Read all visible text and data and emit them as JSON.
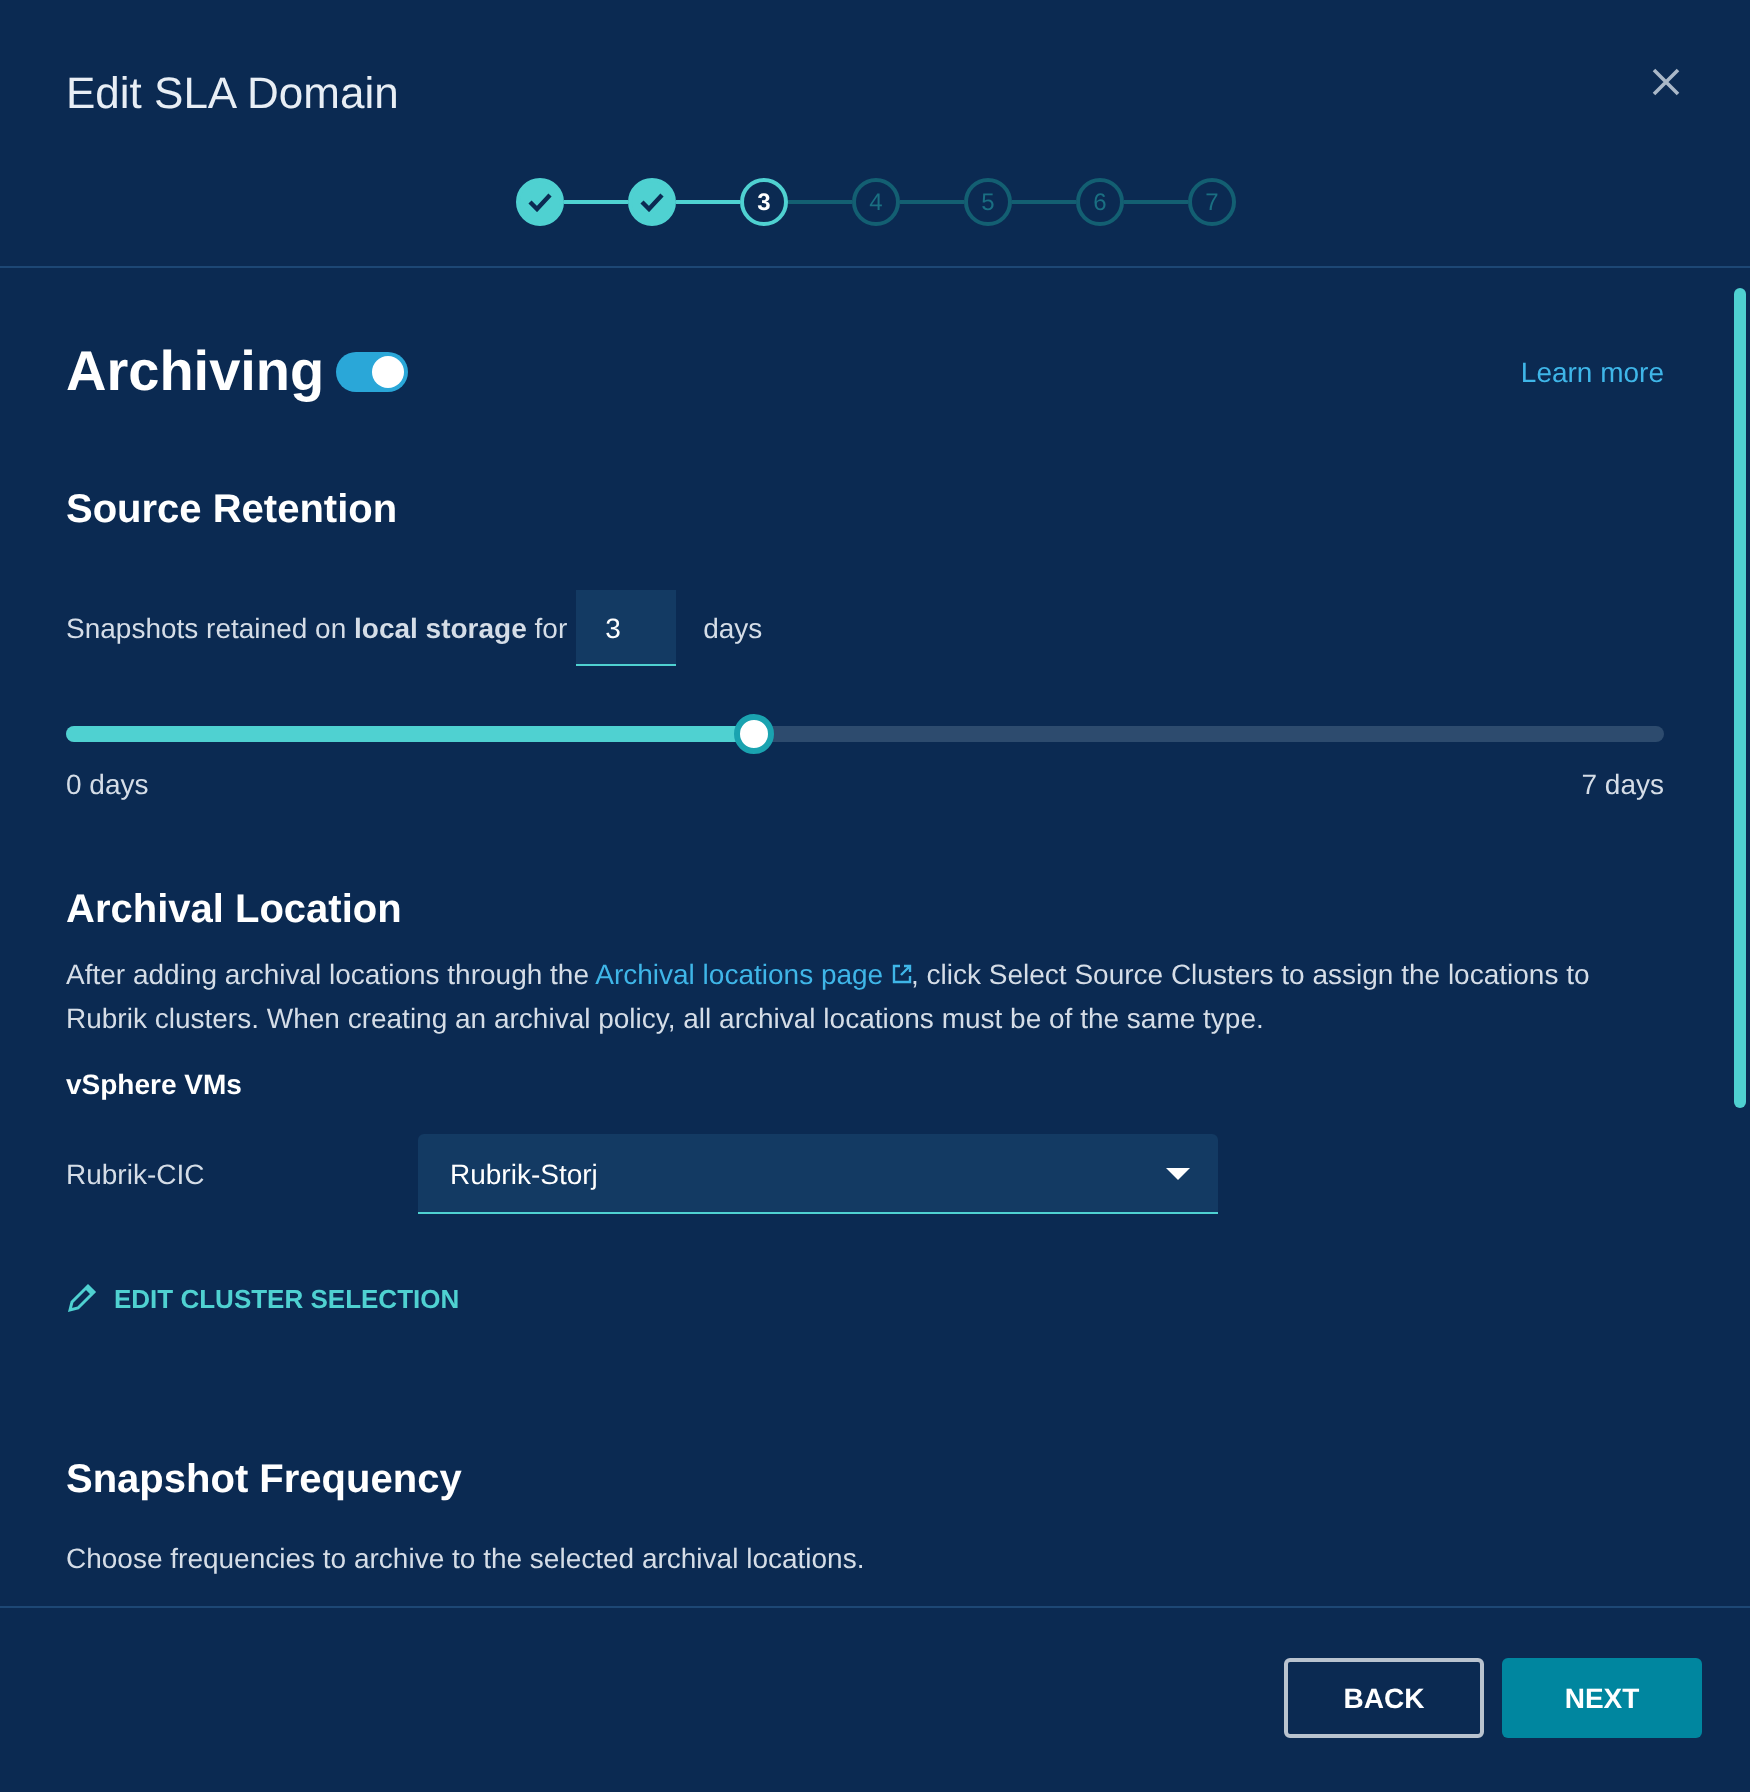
{
  "dialog": {
    "title": "Edit SLA Domain"
  },
  "steps": [
    {
      "completed": true,
      "selected": false
    },
    {
      "completed": true,
      "selected": false
    },
    {
      "label": "3",
      "completed": false,
      "selected": true
    },
    {
      "label": "4",
      "completed": false,
      "selected": false
    },
    {
      "label": "5",
      "completed": false,
      "selected": false
    },
    {
      "label": "6",
      "completed": false,
      "selected": false
    },
    {
      "label": "7",
      "completed": false,
      "selected": false
    }
  ],
  "archiving": {
    "title": "Archiving",
    "on": true,
    "learn_more": "Learn more"
  },
  "source_retention": {
    "heading": "Source Retention",
    "sentence": "Snapshots retained on **local storage** for",
    "value": "3",
    "unit": "days",
    "level": 0.43,
    "min_label": "0 days",
    "max_label": "7 days"
  },
  "archival_location": {
    "heading": "Archival Location",
    "text_before": "After adding archival locations through the",
    "link": "Archival locations page",
    "text_after": ", click Select Source Clusters to assign the locations to Rubrik clusters. When creating an archival policy, all archival locations must be of the same type.",
    "group": "vSphere VMs",
    "cluster": "Rubrik-CIC",
    "location": "Rubrik-Storj",
    "edit": "EDIT CLUSTER SELECTION"
  },
  "snapshot_frequency": {
    "heading": "Snapshot Frequency",
    "text": "Choose frequencies to archive to the selected archival locations."
  },
  "buttons": [
    "BACK",
    "NEXT"
  ]
}
